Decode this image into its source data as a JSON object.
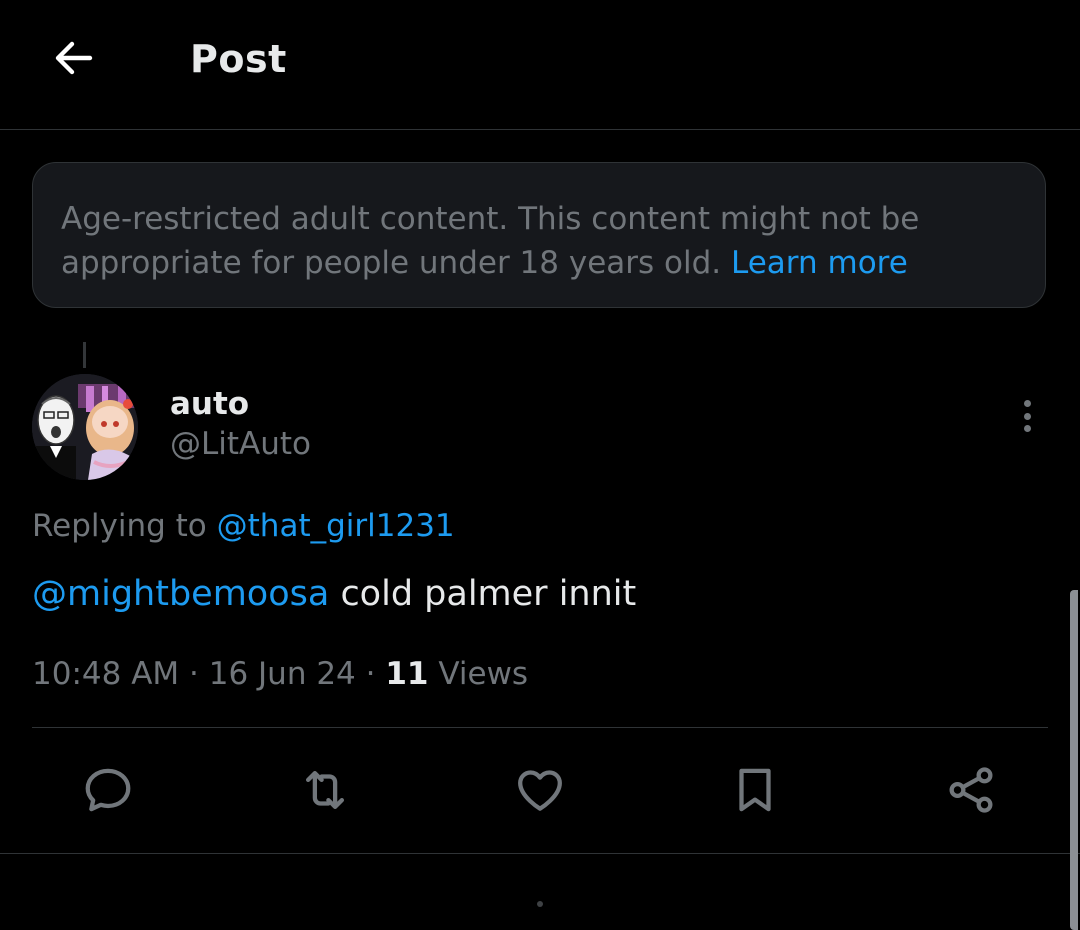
{
  "header": {
    "title": "Post",
    "back_icon": "arrow-left-icon"
  },
  "warning": {
    "text": "Age-restricted adult content. This content might not be appropriate for people under 18 years old.",
    "link_label": "Learn more"
  },
  "author": {
    "display_name": "auto",
    "handle": "@LitAuto",
    "more_icon": "more-vertical-icon"
  },
  "reply_context": {
    "prefix": "Replying to",
    "mention": "@that_girl1231"
  },
  "tweet": {
    "mention": "@mightbemoosa",
    "text": "cold palmer innit"
  },
  "meta": {
    "time": "10:48 AM",
    "separator": "·",
    "date": "16 Jun 24",
    "views_count": "11",
    "views_label": "Views"
  },
  "actions": [
    {
      "name": "reply",
      "icon": "reply-icon"
    },
    {
      "name": "repost",
      "icon": "repost-icon"
    },
    {
      "name": "like",
      "icon": "heart-icon"
    },
    {
      "name": "bookmark",
      "icon": "bookmark-icon"
    },
    {
      "name": "share",
      "icon": "share-icon"
    }
  ],
  "colors": {
    "background": "#000000",
    "text_primary": "#e7e9ea",
    "text_secondary": "#71767b",
    "accent": "#1d9bf0",
    "border": "#2f3336",
    "card": "#16181c"
  }
}
